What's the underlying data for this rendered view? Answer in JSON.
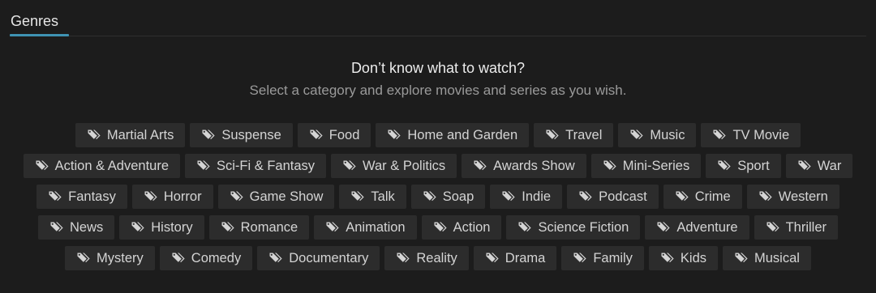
{
  "tabs": [
    {
      "label": "Genres",
      "active": true
    }
  ],
  "hero": {
    "title": "Don’t know what to watch?",
    "subtitle": "Select a category and explore movies and series as you wish."
  },
  "icon": "tags-icon",
  "colors": {
    "background": "#1c1c1c",
    "chip": "#2c2c2c",
    "accent": "#3f93b3"
  },
  "genre_rows": [
    [
      "Martial Arts",
      "Suspense",
      "Food",
      "Home and Garden",
      "Travel",
      "Music",
      "TV Movie"
    ],
    [
      "Action & Adventure",
      "Sci-Fi & Fantasy",
      "War & Politics",
      "Awards Show",
      "Mini-Series",
      "Sport",
      "War"
    ],
    [
      "Fantasy",
      "Horror",
      "Game Show",
      "Talk",
      "Soap",
      "Indie",
      "Podcast",
      "Crime",
      "Western"
    ],
    [
      "News",
      "History",
      "Romance",
      "Animation",
      "Action",
      "Science Fiction",
      "Adventure",
      "Thriller"
    ],
    [
      "Mystery",
      "Comedy",
      "Documentary",
      "Reality",
      "Drama",
      "Family",
      "Kids",
      "Musical"
    ]
  ]
}
